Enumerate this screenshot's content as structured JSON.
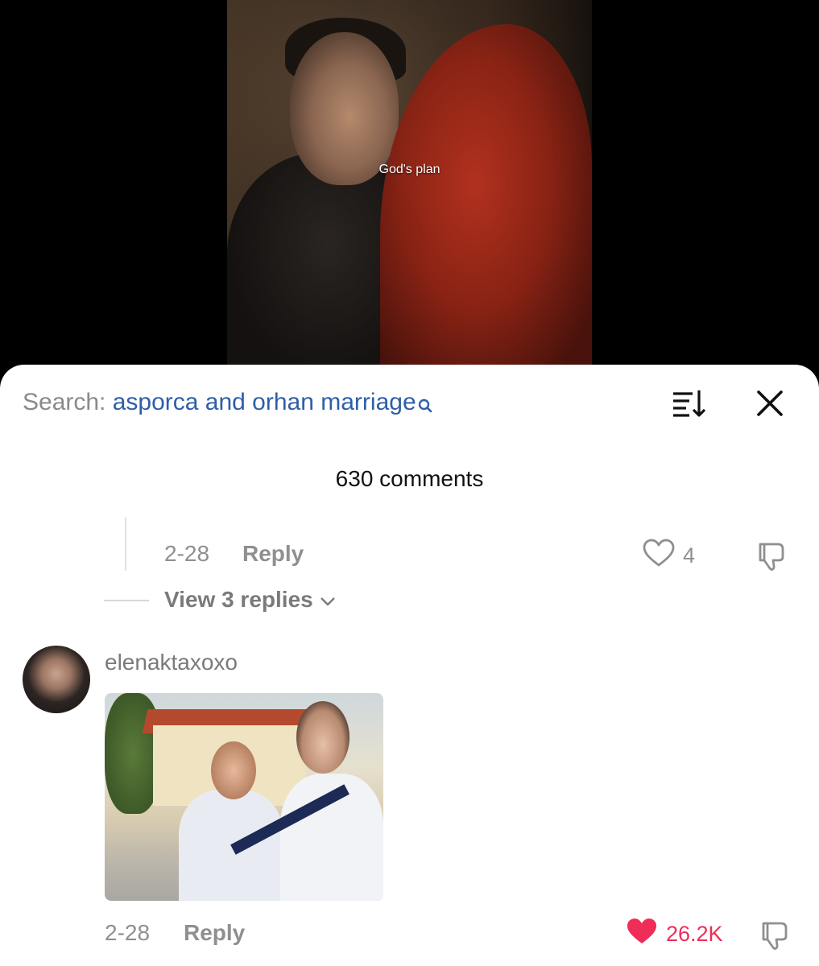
{
  "video": {
    "caption": "God's plan"
  },
  "sheet": {
    "search_label": "Search:",
    "search_query": "asporca and orhan marriage",
    "comment_count": "630 comments"
  },
  "reply_comment": {
    "date": "2-28",
    "reply_label": "Reply",
    "likes": "4",
    "view_replies": "View 3 replies"
  },
  "comment": {
    "username": "elenaktaxoxo",
    "date": "2-28",
    "reply_label": "Reply",
    "likes": "26.2K",
    "liked": true,
    "like_color": "#f02d56"
  },
  "colors": {
    "link": "#2f5ea8",
    "muted": "#8f8f8f",
    "heart_active": "#f02d56"
  }
}
